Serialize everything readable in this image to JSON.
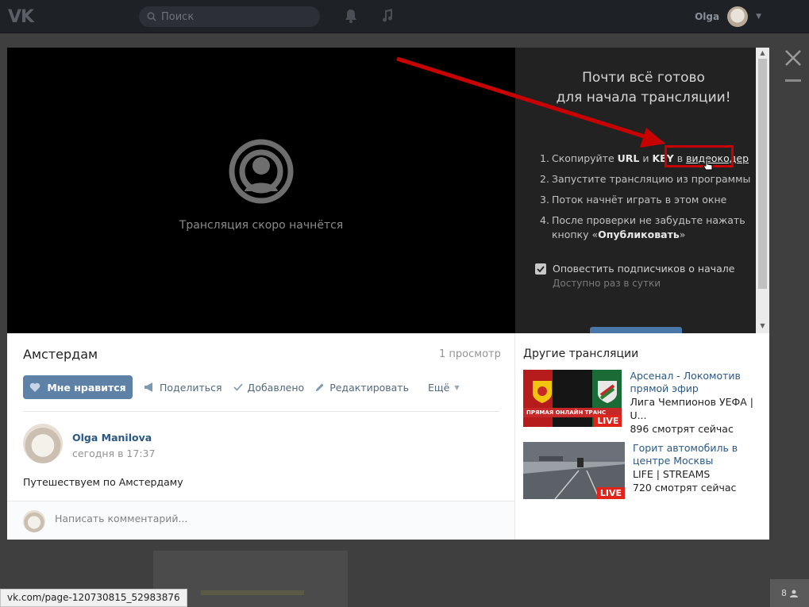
{
  "header": {
    "logo": "VK",
    "search_placeholder": "Поиск",
    "user_name": "Olga"
  },
  "player": {
    "status_text": "Трансляция скоро начнётся"
  },
  "setup": {
    "title_line1": "Почти всё готово",
    "title_line2": "для начала трансляции!",
    "steps": [
      {
        "num": "1.",
        "pre": "Скопируйте ",
        "url": "URL",
        "and": " и ",
        "key": "KEY",
        "in": " в ",
        "link": "видеокодер"
      },
      {
        "num": "2.",
        "text": "Запустите трансляцию из программы"
      },
      {
        "num": "3.",
        "text": "Поток начнёт играть в этом окне"
      },
      {
        "num": "4.",
        "text": "После проверки не забудьте нажать",
        "cont_pre": "кнопку «",
        "cont_bold": "Опубликовать",
        "cont_post": "»"
      }
    ],
    "notify_label": "Оповестить подписчиков о начале",
    "notify_sub": "Доступно раз в сутки",
    "notify_checked": true
  },
  "video": {
    "title": "Амстердам",
    "views": "1 просмотр",
    "like": "Мне нравится",
    "share": "Поделиться",
    "added": "Добавлено",
    "edit": "Редактировать",
    "more": "Ещё",
    "author_name": "Olga Manilova",
    "author_date": "сегодня в 17:37",
    "description": "Путешествуем по Амстердаму",
    "comment_placeholder": "Написать комментарий..."
  },
  "others": {
    "title": "Другие трансляции",
    "items": [
      {
        "title": "Арсенал - Локомотив прямой эфир",
        "channel": "Лига Чемпионов УЕФА | U...",
        "viewers": "896 смотрят сейчас",
        "badge": "LIVE",
        "thumb_text": "ПРЯМАЯ ОНЛАЙН ТРАНС"
      },
      {
        "title": "Горит автомобиль в центре Москвы",
        "channel": "LIFE | STREAMS",
        "viewers": "720 смотрят сейчас",
        "badge": "LIVE"
      }
    ]
  },
  "status_url": "vk.com/page-120730815_52983876",
  "online_count": "8",
  "colors": {
    "accent": "#4a76a8",
    "link": "#2a5885",
    "live": "#e0241b",
    "annotation": "#c90000"
  }
}
